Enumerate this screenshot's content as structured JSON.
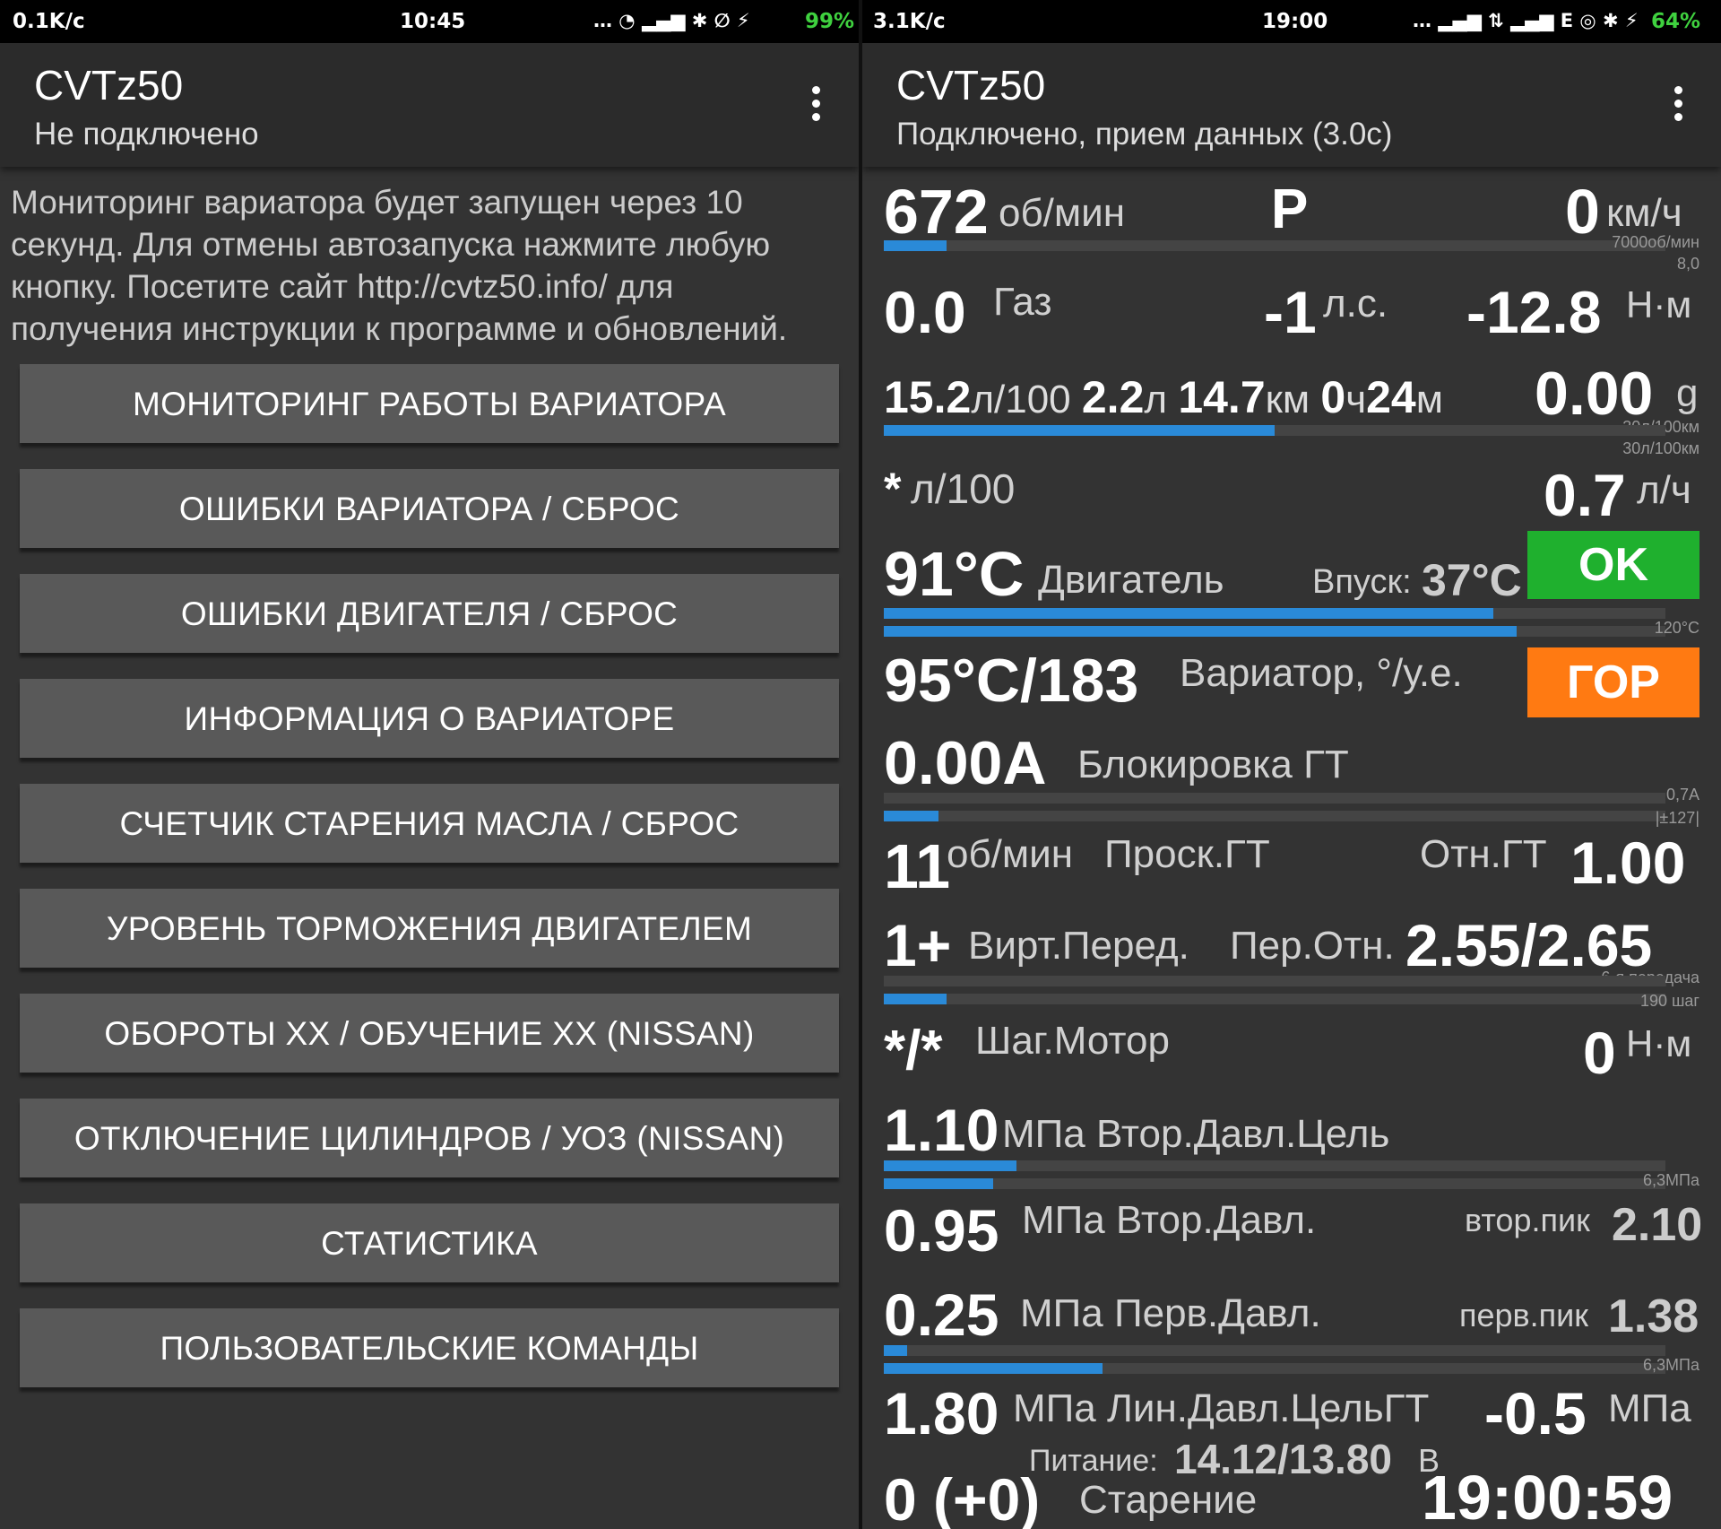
{
  "left": {
    "status": {
      "speed": "0.1K/c",
      "time": "10:45",
      "icons": "… ◔ ▂▄▆ ✱ ∅ ⚡",
      "battery": "99%"
    },
    "appbar": {
      "title": "CVTz50",
      "subtitle": "Не подключено"
    },
    "notice_lines": [
      "Мониторинг вариатора будет запущен через 10",
      "секунд. Для отмены автозапуска нажмите любую",
      "кнопку. Посетите сайт http://cvtz50.info/ для",
      "получения инструкции к программе и обновлений."
    ],
    "buttons": [
      "МОНИТОРИНГ РАБОТЫ ВАРИАТОРА",
      "ОШИБКИ ВАРИАТОРА / СБРОС",
      "ОШИБКИ ДВИГАТЕЛЯ / СБРОС",
      "ИНФОРМАЦИЯ О ВАРИАТОРЕ",
      "СЧЕТЧИК СТАРЕНИЯ МАСЛА / СБРОС",
      "УРОВЕНЬ ТОРМОЖЕНИЯ ДВИГАТЕЛЕМ",
      "ОБОРОТЫ ХХ / ОБУЧЕНИЕ ХХ (NISSAN)",
      "ОТКЛЮЧЕНИЕ ЦИЛИНДРОВ / УОЗ (NISSAN)",
      "СТАТИСТИКА",
      "ПОЛЬЗОВАТЕЛЬСКИЕ КОМАНДЫ"
    ]
  },
  "right": {
    "status": {
      "speed": "3.1K/c",
      "time": "19:00",
      "icons": "… ▂▄▆ ⇅ ▂▄▆ E ◎ ✱ ⚡",
      "battery": "64%"
    },
    "appbar": {
      "title": "CVTz50",
      "subtitle": "Подключено, прием данных (3.0с)"
    },
    "rpm": {
      "value": "672",
      "unit": "об/мин",
      "max": "7000об/мин",
      "fraction": 0.08
    },
    "gear": "P",
    "speed": {
      "value": "0",
      "unit": "км/ч"
    },
    "accel_scale": "8,0",
    "gas": {
      "value": "0.0",
      "label": "Газ"
    },
    "hp": {
      "value": "-1",
      "unit": "л.с."
    },
    "torque": {
      "value": "-12.8",
      "unit": "Н·м"
    },
    "fuel_avg": {
      "value": "15.2",
      "unit": "л/100"
    },
    "fuel_used": {
      "value": "2.2",
      "unit": "л"
    },
    "distance": {
      "value": "14.7",
      "unit": "км"
    },
    "duration": {
      "h": "0",
      "h_unit": "ч",
      "m": "24",
      "m_unit": "м"
    },
    "g_force": {
      "value": "0.00",
      "unit": "g"
    },
    "fuel_scale1": "30л/100км",
    "fuel_scale2": "30л/100км",
    "fuel_fraction": 0.5,
    "fuel_instant": {
      "value": "*",
      "unit": "л/100"
    },
    "fuel_hour": {
      "value": "0.7",
      "unit": "л/ч"
    },
    "engine_temp": {
      "value": "91°C",
      "label": "Двигатель",
      "intake_label": "Впуск:",
      "intake_value": "37°C",
      "status": "OK",
      "scale": "120°C",
      "fraction1": 0.78,
      "fraction2": 0.81
    },
    "cvt_temp": {
      "value": "95°C/183",
      "label": "Вариатор, °/у.е.",
      "status": "ГОР"
    },
    "lockup": {
      "value": "0.00A",
      "label": "Блокировка ГТ",
      "scale1": "0,7A",
      "scale2": "|±127|",
      "fraction": 0.07
    },
    "slip": {
      "value": "11",
      "unit": "об/мин",
      "label": "Проск.ГТ",
      "ratio_label": "Отн.ГТ",
      "ratio_value": "1.00"
    },
    "vgear": {
      "value": "1+",
      "label": "Вирт.Перед.",
      "ratio_label": "Пер.Отн.",
      "ratio_value": "2.55/2.65",
      "scale1": "6-я передача",
      "scale2": "190 шаг",
      "fraction": 0.08
    },
    "stepper": {
      "value": "*/*",
      "label": "Шаг.Мотор",
      "torque_value": "0",
      "torque_unit": "Н·м"
    },
    "sec_target": {
      "value": "1.10",
      "unit": "МПа",
      "label": "Втор.Давл.Цель",
      "scale": "6,3МПа",
      "fraction1": 0.17,
      "fraction2": 0.14
    },
    "sec_pressure": {
      "value": "0.95",
      "unit": "МПа",
      "label": "Втор.Давл.",
      "peak_label": "втор.пик",
      "peak_value": "2.10"
    },
    "pri_pressure": {
      "value": "0.25",
      "unit": "МПа",
      "label": "Перв.Давл.",
      "peak_label": "перв.пик",
      "peak_value": "1.38",
      "scale": "6,3МПа",
      "fraction1": 0.03,
      "fraction2": 0.28
    },
    "line_target": {
      "value": "1.80",
      "unit": "МПа",
      "label": "Лин.Давл.ЦельГТ",
      "delta_value": "-0.5",
      "delta_unit": "МПа"
    },
    "power": {
      "label": "Питание:",
      "value": "14.12/13.80",
      "unit": "В"
    },
    "aging": {
      "value": "0 (+0)",
      "label": "Старение"
    },
    "clock": "19:00:59",
    "colors": {
      "ok": "#1fb02e",
      "hot": "#ff7a12",
      "bar": "#2a8ad8"
    }
  }
}
